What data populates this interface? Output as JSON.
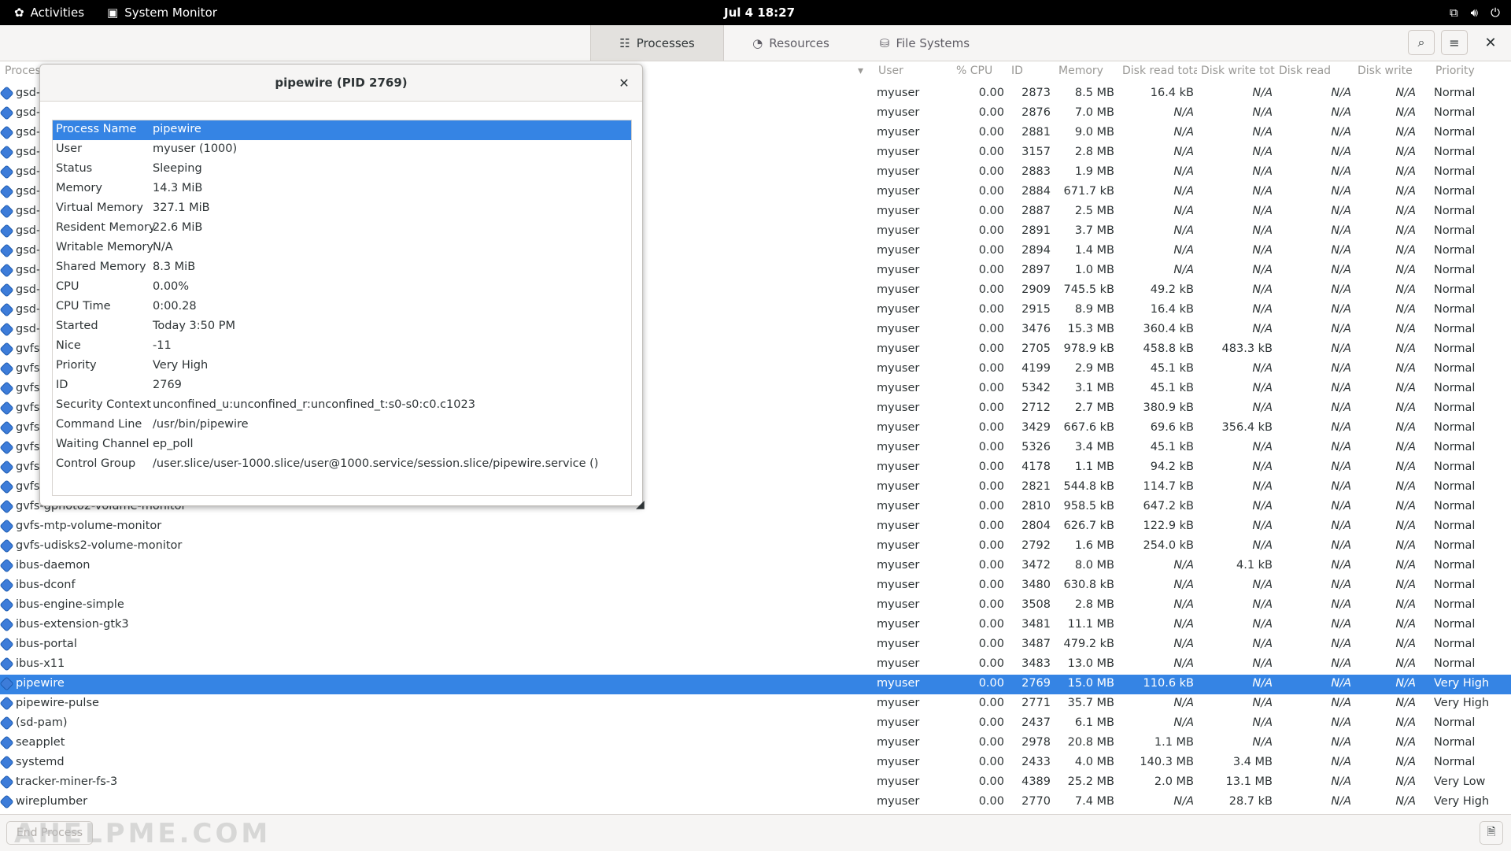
{
  "topbar": {
    "activities": "Activities",
    "app_name": "System Monitor",
    "clock": "Jul 4  18:27"
  },
  "tabs": [
    {
      "label": "Processes",
      "icon": "processes-icon",
      "active": true
    },
    {
      "label": "Resources",
      "icon": "resources-icon",
      "active": false
    },
    {
      "label": "File Systems",
      "icon": "filesystems-icon",
      "active": false
    }
  ],
  "columns": {
    "name": "Proces",
    "user": "User",
    "cpu": "% CPU",
    "id": "ID",
    "memory": "Memory",
    "disk_read_total": "Disk read tota",
    "disk_write_total": "Disk write tot",
    "disk_read": "Disk read",
    "disk_write": "Disk write",
    "priority": "Priority"
  },
  "rows": [
    {
      "name": "gsd-",
      "user": "myuser",
      "cpu": "0.00",
      "id": "2873",
      "mem": "8.5 MB",
      "drt": "16.4 kB",
      "dwt": "N/A",
      "dr": "N/A",
      "dw": "N/A",
      "pri": "Normal"
    },
    {
      "name": "gsd-",
      "user": "myuser",
      "cpu": "0.00",
      "id": "2876",
      "mem": "7.0 MB",
      "drt": "N/A",
      "dwt": "N/A",
      "dr": "N/A",
      "dw": "N/A",
      "pri": "Normal"
    },
    {
      "name": "gsd-",
      "user": "myuser",
      "cpu": "0.00",
      "id": "2881",
      "mem": "9.0 MB",
      "drt": "N/A",
      "dwt": "N/A",
      "dr": "N/A",
      "dw": "N/A",
      "pri": "Normal"
    },
    {
      "name": "gsd-",
      "user": "myuser",
      "cpu": "0.00",
      "id": "3157",
      "mem": "2.8 MB",
      "drt": "N/A",
      "dwt": "N/A",
      "dr": "N/A",
      "dw": "N/A",
      "pri": "Normal"
    },
    {
      "name": "gsd-",
      "user": "myuser",
      "cpu": "0.00",
      "id": "2883",
      "mem": "1.9 MB",
      "drt": "N/A",
      "dwt": "N/A",
      "dr": "N/A",
      "dw": "N/A",
      "pri": "Normal"
    },
    {
      "name": "gsd-",
      "user": "myuser",
      "cpu": "0.00",
      "id": "2884",
      "mem": "671.7 kB",
      "drt": "N/A",
      "dwt": "N/A",
      "dr": "N/A",
      "dw": "N/A",
      "pri": "Normal"
    },
    {
      "name": "gsd-",
      "user": "myuser",
      "cpu": "0.00",
      "id": "2887",
      "mem": "2.5 MB",
      "drt": "N/A",
      "dwt": "N/A",
      "dr": "N/A",
      "dw": "N/A",
      "pri": "Normal"
    },
    {
      "name": "gsd-",
      "user": "myuser",
      "cpu": "0.00",
      "id": "2891",
      "mem": "3.7 MB",
      "drt": "N/A",
      "dwt": "N/A",
      "dr": "N/A",
      "dw": "N/A",
      "pri": "Normal"
    },
    {
      "name": "gsd-",
      "user": "myuser",
      "cpu": "0.00",
      "id": "2894",
      "mem": "1.4 MB",
      "drt": "N/A",
      "dwt": "N/A",
      "dr": "N/A",
      "dw": "N/A",
      "pri": "Normal"
    },
    {
      "name": "gsd-",
      "user": "myuser",
      "cpu": "0.00",
      "id": "2897",
      "mem": "1.0 MB",
      "drt": "N/A",
      "dwt": "N/A",
      "dr": "N/A",
      "dw": "N/A",
      "pri": "Normal"
    },
    {
      "name": "gsd-",
      "user": "myuser",
      "cpu": "0.00",
      "id": "2909",
      "mem": "745.5 kB",
      "drt": "49.2 kB",
      "dwt": "N/A",
      "dr": "N/A",
      "dw": "N/A",
      "pri": "Normal"
    },
    {
      "name": "gsd-",
      "user": "myuser",
      "cpu": "0.00",
      "id": "2915",
      "mem": "8.9 MB",
      "drt": "16.4 kB",
      "dwt": "N/A",
      "dr": "N/A",
      "dw": "N/A",
      "pri": "Normal"
    },
    {
      "name": "gsd-",
      "user": "myuser",
      "cpu": "0.00",
      "id": "3476",
      "mem": "15.3 MB",
      "drt": "360.4 kB",
      "dwt": "N/A",
      "dr": "N/A",
      "dw": "N/A",
      "pri": "Normal"
    },
    {
      "name": "gvfs",
      "user": "myuser",
      "cpu": "0.00",
      "id": "2705",
      "mem": "978.9 kB",
      "drt": "458.8 kB",
      "dwt": "483.3 kB",
      "dr": "N/A",
      "dw": "N/A",
      "pri": "Normal"
    },
    {
      "name": "gvfs",
      "user": "myuser",
      "cpu": "0.00",
      "id": "4199",
      "mem": "2.9 MB",
      "drt": "45.1 kB",
      "dwt": "N/A",
      "dr": "N/A",
      "dw": "N/A",
      "pri": "Normal"
    },
    {
      "name": "gvfs",
      "user": "myuser",
      "cpu": "0.00",
      "id": "5342",
      "mem": "3.1 MB",
      "drt": "45.1 kB",
      "dwt": "N/A",
      "dr": "N/A",
      "dw": "N/A",
      "pri": "Normal"
    },
    {
      "name": "gvfs",
      "user": "myuser",
      "cpu": "0.00",
      "id": "2712",
      "mem": "2.7 MB",
      "drt": "380.9 kB",
      "dwt": "N/A",
      "dr": "N/A",
      "dw": "N/A",
      "pri": "Normal"
    },
    {
      "name": "gvfs",
      "user": "myuser",
      "cpu": "0.00",
      "id": "3429",
      "mem": "667.6 kB",
      "drt": "69.6 kB",
      "dwt": "356.4 kB",
      "dr": "N/A",
      "dw": "N/A",
      "pri": "Normal"
    },
    {
      "name": "gvfs",
      "user": "myuser",
      "cpu": "0.00",
      "id": "5326",
      "mem": "3.4 MB",
      "drt": "45.1 kB",
      "dwt": "N/A",
      "dr": "N/A",
      "dw": "N/A",
      "pri": "Normal"
    },
    {
      "name": "gvfs",
      "user": "myuser",
      "cpu": "0.00",
      "id": "4178",
      "mem": "1.1 MB",
      "drt": "94.2 kB",
      "dwt": "N/A",
      "dr": "N/A",
      "dw": "N/A",
      "pri": "Normal"
    },
    {
      "name": "gvfs-",
      "user": "myuser",
      "cpu": "0.00",
      "id": "2821",
      "mem": "544.8 kB",
      "drt": "114.7 kB",
      "dwt": "N/A",
      "dr": "N/A",
      "dw": "N/A",
      "pri": "Normal"
    },
    {
      "name": "gvfs-gphoto2-volume-monitor",
      "user": "myuser",
      "cpu": "0.00",
      "id": "2810",
      "mem": "958.5 kB",
      "drt": "647.2 kB",
      "dwt": "N/A",
      "dr": "N/A",
      "dw": "N/A",
      "pri": "Normal"
    },
    {
      "name": "gvfs-mtp-volume-monitor",
      "user": "myuser",
      "cpu": "0.00",
      "id": "2804",
      "mem": "626.7 kB",
      "drt": "122.9 kB",
      "dwt": "N/A",
      "dr": "N/A",
      "dw": "N/A",
      "pri": "Normal"
    },
    {
      "name": "gvfs-udisks2-volume-monitor",
      "user": "myuser",
      "cpu": "0.00",
      "id": "2792",
      "mem": "1.6 MB",
      "drt": "254.0 kB",
      "dwt": "N/A",
      "dr": "N/A",
      "dw": "N/A",
      "pri": "Normal"
    },
    {
      "name": "ibus-daemon",
      "user": "myuser",
      "cpu": "0.00",
      "id": "3472",
      "mem": "8.0 MB",
      "drt": "N/A",
      "dwt": "4.1 kB",
      "dr": "N/A",
      "dw": "N/A",
      "pri": "Normal"
    },
    {
      "name": "ibus-dconf",
      "user": "myuser",
      "cpu": "0.00",
      "id": "3480",
      "mem": "630.8 kB",
      "drt": "N/A",
      "dwt": "N/A",
      "dr": "N/A",
      "dw": "N/A",
      "pri": "Normal"
    },
    {
      "name": "ibus-engine-simple",
      "user": "myuser",
      "cpu": "0.00",
      "id": "3508",
      "mem": "2.8 MB",
      "drt": "N/A",
      "dwt": "N/A",
      "dr": "N/A",
      "dw": "N/A",
      "pri": "Normal"
    },
    {
      "name": "ibus-extension-gtk3",
      "user": "myuser",
      "cpu": "0.00",
      "id": "3481",
      "mem": "11.1 MB",
      "drt": "N/A",
      "dwt": "N/A",
      "dr": "N/A",
      "dw": "N/A",
      "pri": "Normal"
    },
    {
      "name": "ibus-portal",
      "user": "myuser",
      "cpu": "0.00",
      "id": "3487",
      "mem": "479.2 kB",
      "drt": "N/A",
      "dwt": "N/A",
      "dr": "N/A",
      "dw": "N/A",
      "pri": "Normal"
    },
    {
      "name": "ibus-x11",
      "user": "myuser",
      "cpu": "0.00",
      "id": "3483",
      "mem": "13.0 MB",
      "drt": "N/A",
      "dwt": "N/A",
      "dr": "N/A",
      "dw": "N/A",
      "pri": "Normal"
    },
    {
      "name": "pipewire",
      "user": "myuser",
      "cpu": "0.00",
      "id": "2769",
      "mem": "15.0 MB",
      "drt": "110.6 kB",
      "dwt": "N/A",
      "dr": "N/A",
      "dw": "N/A",
      "pri": "Very High",
      "selected": true
    },
    {
      "name": "pipewire-pulse",
      "user": "myuser",
      "cpu": "0.00",
      "id": "2771",
      "mem": "35.7 MB",
      "drt": "N/A",
      "dwt": "N/A",
      "dr": "N/A",
      "dw": "N/A",
      "pri": "Very High"
    },
    {
      "name": "(sd-pam)",
      "user": "myuser",
      "cpu": "0.00",
      "id": "2437",
      "mem": "6.1 MB",
      "drt": "N/A",
      "dwt": "N/A",
      "dr": "N/A",
      "dw": "N/A",
      "pri": "Normal"
    },
    {
      "name": "seapplet",
      "user": "myuser",
      "cpu": "0.00",
      "id": "2978",
      "mem": "20.8 MB",
      "drt": "1.1 MB",
      "dwt": "N/A",
      "dr": "N/A",
      "dw": "N/A",
      "pri": "Normal"
    },
    {
      "name": "systemd",
      "user": "myuser",
      "cpu": "0.00",
      "id": "2433",
      "mem": "4.0 MB",
      "drt": "140.3 MB",
      "dwt": "3.4 MB",
      "dr": "N/A",
      "dw": "N/A",
      "pri": "Normal"
    },
    {
      "name": "tracker-miner-fs-3",
      "user": "myuser",
      "cpu": "0.00",
      "id": "4389",
      "mem": "25.2 MB",
      "drt": "2.0 MB",
      "dwt": "13.1 MB",
      "dr": "N/A",
      "dw": "N/A",
      "pri": "Very Low"
    },
    {
      "name": "wireplumber",
      "user": "myuser",
      "cpu": "0.00",
      "id": "2770",
      "mem": "7.4 MB",
      "drt": "N/A",
      "dwt": "28.7 kB",
      "dr": "N/A",
      "dw": "N/A",
      "pri": "Very High"
    }
  ],
  "bottom": {
    "end_process": "End Process",
    "watermark": "AHELPME.COM"
  },
  "dialog": {
    "title": "pipewire (PID 2769)",
    "properties": [
      {
        "k": "Process Name",
        "v": "pipewire",
        "selected": true
      },
      {
        "k": "User",
        "v": "myuser (1000)"
      },
      {
        "k": "Status",
        "v": "Sleeping"
      },
      {
        "k": "Memory",
        "v": "14.3 MiB"
      },
      {
        "k": "Virtual Memory",
        "v": "327.1 MiB"
      },
      {
        "k": "Resident Memory",
        "v": "22.6 MiB"
      },
      {
        "k": "Writable Memory",
        "v": "N/A"
      },
      {
        "k": "Shared Memory",
        "v": "8.3 MiB"
      },
      {
        "k": "CPU",
        "v": "0.00%"
      },
      {
        "k": "CPU Time",
        "v": "0:00.28"
      },
      {
        "k": "Started",
        "v": "Today  3:50 PM"
      },
      {
        "k": "Nice",
        "v": "-11"
      },
      {
        "k": "Priority",
        "v": "Very High"
      },
      {
        "k": "ID",
        "v": "2769"
      },
      {
        "k": "Security Context",
        "v": "unconfined_u:unconfined_r:unconfined_t:s0-s0:c0.c1023"
      },
      {
        "k": "Command Line",
        "v": "/usr/bin/pipewire"
      },
      {
        "k": "Waiting Channel",
        "v": "ep_poll"
      },
      {
        "k": "Control Group",
        "v": "/user.slice/user-1000.slice/user@1000.service/session.slice/pipewire.service ()"
      }
    ]
  },
  "colors": {
    "accent": "#3584e4",
    "topbar": "#000000",
    "header": "#f6f5f4"
  }
}
